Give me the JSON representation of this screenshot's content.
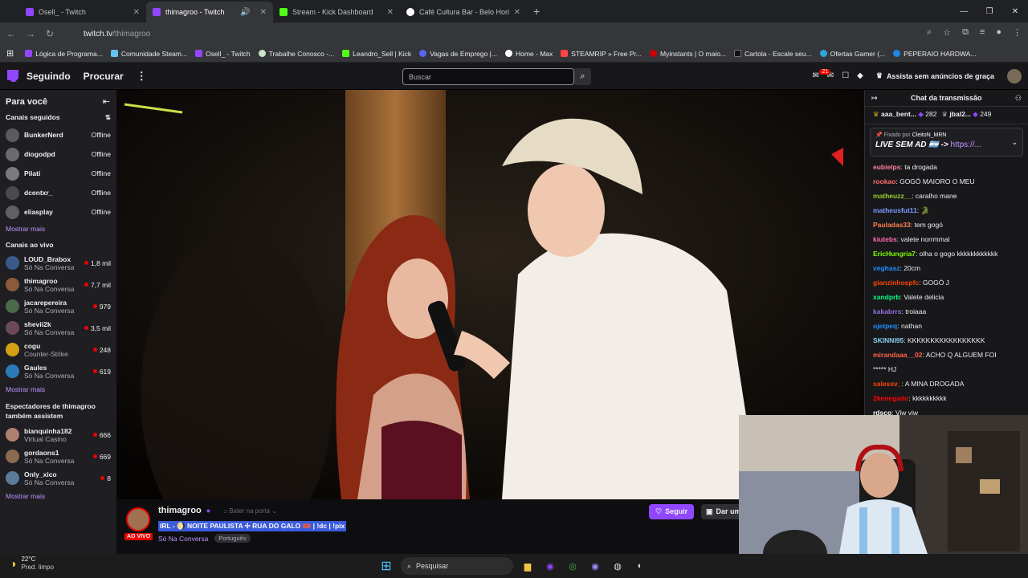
{
  "tabs": [
    {
      "title": "Osell_ - Twitch",
      "color": "#9147ff"
    },
    {
      "title": "thimagroo - Twitch",
      "color": "#9147ff"
    },
    {
      "title": "Stream - Kick Dashboard",
      "color": "#53fc18"
    },
    {
      "title": "Café Cultura Bar - Belo Horizon",
      "color": "#ffffff"
    }
  ],
  "address": {
    "host": "twitch.tv",
    "path": "/thimagroo"
  },
  "bookmarks": [
    {
      "label": "Lógica de Programa...",
      "color": "#9147ff"
    },
    {
      "label": "Comunidade Steam...",
      "color": "#66c0f4"
    },
    {
      "label": "Osell_ - Twitch",
      "color": "#9147ff"
    },
    {
      "label": "Trabalhe Conosco -...",
      "color": "#c8e6c9"
    },
    {
      "label": "Leandro_Sell | Kick",
      "color": "#53fc18"
    },
    {
      "label": "Vagas de Emprego |...",
      "color": "#5865f2"
    },
    {
      "label": "Home - Max",
      "color": "#ffffff"
    },
    {
      "label": "STEAMRIP » Free Pr...",
      "color": "#ff4444"
    },
    {
      "label": "Myinstants | O maio...",
      "color": "#cc0000"
    },
    {
      "label": "Cartola - Escale seu...",
      "color": "#111111"
    },
    {
      "label": "Ofertas Gamer (...",
      "color": "#2ca5e0"
    },
    {
      "label": "PEPERAIO HARDWA...",
      "color": "#1e88e5"
    }
  ],
  "nav": {
    "following": "Seguindo",
    "browse": "Procurar",
    "search_placeholder": "Buscar",
    "notif_count": "21",
    "prime": "Assista sem anúncios de graça"
  },
  "sidebar": {
    "for_you": "Para você",
    "followed": "Canais seguidos",
    "followed_channels": [
      {
        "name": "BunkerNerd",
        "status": "Offline",
        "color": "#5a5a60"
      },
      {
        "name": "diogodpd",
        "status": "Offline",
        "color": "#6a6a70"
      },
      {
        "name": "Pilati",
        "status": "Offline",
        "color": "#7a7a80"
      },
      {
        "name": "dcentxr_",
        "status": "Offline",
        "color": "#4a4a50"
      },
      {
        "name": "eliasplay",
        "status": "Offline",
        "color": "#5f5f66"
      }
    ],
    "show_more": "Mostrar mais",
    "live_title": "Canais ao vivo",
    "live_channels": [
      {
        "name": "LOUD_Brabox",
        "category": "Só Na Conversa",
        "viewers": "1,8 mil",
        "color": "#3a5a8a"
      },
      {
        "name": "thimagroo",
        "category": "Só Na Conversa",
        "viewers": "7,7 mil",
        "color": "#8a5a3a"
      },
      {
        "name": "jacarepereira",
        "category": "Só Na Conversa",
        "viewers": "979",
        "color": "#4a6a4a"
      },
      {
        "name": "shevii2k",
        "category": "Só Na Conversa",
        "viewers": "3,5 mil",
        "color": "#6a4a5a"
      },
      {
        "name": "cogu",
        "category": "Counter-Strike",
        "viewers": "248",
        "color": "#d4a017"
      },
      {
        "name": "Gaules",
        "category": "Só Na Conversa",
        "viewers": "619",
        "color": "#2b7bb9"
      }
    ],
    "show_more2": "Mostrar mais",
    "also_title": "Espectadores de thimagroo também assistem",
    "also_channels": [
      {
        "name": "bianquinha182",
        "category": "Virtual Casino",
        "viewers": "666",
        "color": "#b08070"
      },
      {
        "name": "gordaons1",
        "category": "Só Na Conversa",
        "viewers": "669",
        "color": "#8a6a50"
      },
      {
        "name": "Only_xico",
        "category": "Só Na Conversa",
        "viewers": "8",
        "color": "#5a7a9a"
      }
    ],
    "show_more3": "Mostrar mais"
  },
  "stream": {
    "channel": "thimagroo",
    "knock": "Bater na porta",
    "title": "IRL - 🌖 NOITE PAULISTA ✢ RUA DO GALO 🎟️ | !dc | !pix",
    "live": "AO VIVO",
    "category": "Só Na Conversa",
    "tag": "Português",
    "follow": "Seguir",
    "sub": "Dar um"
  },
  "chat": {
    "title": "Chat da transmissão",
    "gift1_user": "aaa_bent...",
    "gift1_count": "282",
    "gift2_user": "jbal2...",
    "gift2_count": "249",
    "pinned_by": "Fixado por",
    "pinned_user": "CleitoN_MRN",
    "pinned_text": "LIVE SEM AD 🇦🇷 ->",
    "pinned_link": "https://...",
    "messages": [
      {
        "user": "eubielps",
        "color": "#ff7f9f",
        "text": "ta drogada"
      },
      {
        "user": "rookao",
        "color": "#ff6b6b",
        "text": "GOGÓ MAIORO O MEU"
      },
      {
        "user": "matheuzz__",
        "color": "#9acd32",
        "text": "caralho mane"
      },
      {
        "user": "matheusfut11",
        "color": "#7b9cff",
        "text": "🐊"
      },
      {
        "user": "Pauladas33",
        "color": "#ff7f50",
        "text": "tem gogó"
      },
      {
        "user": "kiutebs",
        "color": "#ff69b4",
        "text": "valete norrmmal"
      },
      {
        "user": "EricHungria7",
        "color": "#7fff00",
        "text": "olha o gogo kkkkkkkkkkkk"
      },
      {
        "user": "veghasz",
        "color": "#1e90ff",
        "text": "20cm"
      },
      {
        "user": "gianzinhospfc",
        "color": "#ff4500",
        "text": "GOGÓ J"
      },
      {
        "user": "xandprb",
        "color": "#00ff7f",
        "text": "Valete delicia"
      },
      {
        "user": "kakabrrs",
        "color": "#9370db",
        "text": "troiaaa"
      },
      {
        "user": "ojetpeq",
        "color": "#1e90ff",
        "text": "nathan"
      },
      {
        "user": "SKINNI95",
        "color": "#87ceeb",
        "text": "KKKKKKKKKKKKKKKKK"
      },
      {
        "user": "mirandaaa__02",
        "color": "#ff6347",
        "text": "ACHO Q ALGUEM FOI"
      },
      {
        "user": "",
        "color": "#ffffff",
        "text": "***** HJ"
      },
      {
        "user": "salesxv_",
        "color": "#ff4500",
        "text": "A MINA DROGADA"
      },
      {
        "user": "2kenegado",
        "color": "#ff0000",
        "text": "kkkkkkkkkk"
      },
      {
        "user": "rdsco",
        "color": "#ffffff",
        "text": "Viw viw"
      }
    ]
  },
  "taskbar": {
    "temp": "22°C",
    "weather": "Pred. limpo",
    "search": "Pesquisar"
  }
}
